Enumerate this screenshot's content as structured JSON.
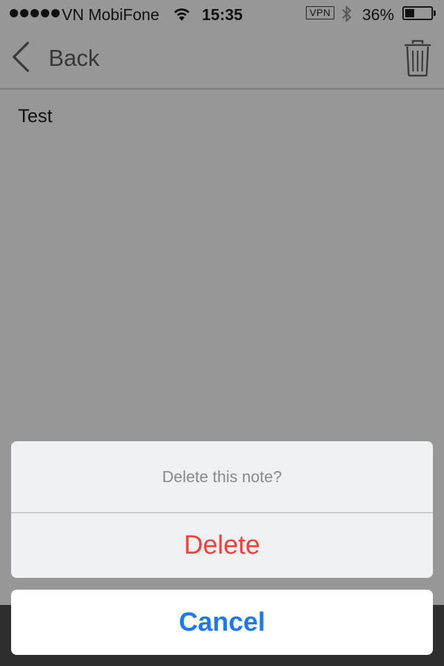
{
  "status_bar": {
    "carrier": "VN MobiFone",
    "time": "15:35",
    "vpn": "VPN",
    "battery_percent": "36%",
    "battery_level": 0.36,
    "signal_bars": 5,
    "icons": [
      "signal-dots-icon",
      "wifi-icon",
      "bluetooth-icon",
      "battery-icon"
    ]
  },
  "nav": {
    "back_label": "Back",
    "icons": [
      "chevron-left-icon",
      "trash-icon"
    ]
  },
  "note": {
    "body": "Test"
  },
  "action_sheet": {
    "title": "Delete this note?",
    "delete_label": "Delete",
    "cancel_label": "Cancel"
  },
  "colors": {
    "dimmed_background": "#979797",
    "destructive": "#f4403a",
    "accent": "#1a7af2",
    "sheet_background": "#eff0f2"
  }
}
